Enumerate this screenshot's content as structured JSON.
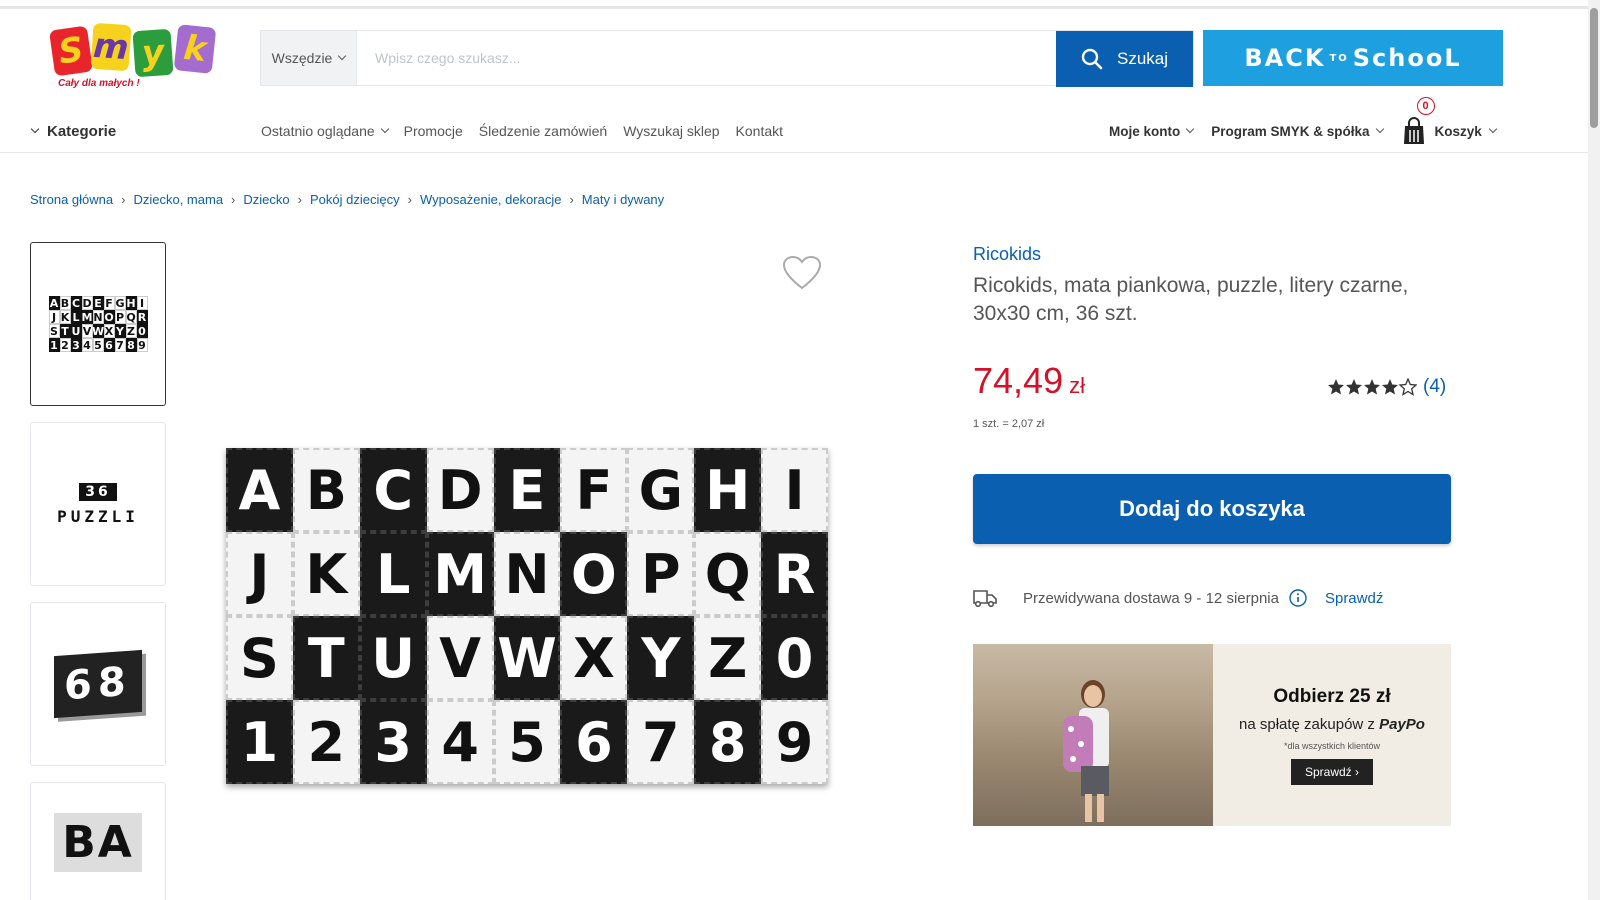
{
  "logo": {
    "letters": [
      "S",
      "m",
      "y",
      "k"
    ],
    "slogan": "Cały dla małych !"
  },
  "search": {
    "scope": "Wszędzie",
    "placeholder": "Wpisz czego szukasz...",
    "value": "",
    "button_label": "Szukaj"
  },
  "promo_banner_top": {
    "text": "BACK",
    "small": "TO",
    "text2": "SchooL"
  },
  "nav": {
    "categories_label": "Kategorie",
    "links": [
      "Ostatnio oglądane",
      "Promocje",
      "Śledzenie zamówień",
      "Wyszukaj sklep",
      "Kontakt"
    ],
    "account_label": "Moje konto",
    "program_label": "Program SMYK & spółka",
    "cart_label": "Koszyk",
    "cart_count": "0"
  },
  "breadcrumb": [
    "Strona główna",
    "Dziecko, mama",
    "Dziecko",
    "Pokój dziecięcy",
    "Wyposażenie, dekoracje",
    "Maty i dywany"
  ],
  "thumbnails": {
    "thumb2_top": "36",
    "thumb2_bottom": "PUZZLI",
    "thumb3_text": "68",
    "thumb4_text": "BA"
  },
  "product": {
    "brand": "Ricokids",
    "title": "Ricokids, mata piankowa, puzzle, litery czarne, 30x30 cm, 36 szt.",
    "price": "74,49",
    "currency": "zł",
    "unit_price": "1 szt. = 2,07 zł",
    "rating_value": 4.5,
    "rating_count": "(4)",
    "add_to_cart_label": "Dodaj do koszyka",
    "delivery_text": "Przewidywana dostawa 9 - 12 sierpnia",
    "delivery_check_label": "Sprawdź"
  },
  "mat_tiles": [
    [
      "A",
      "b"
    ],
    [
      "B",
      "w"
    ],
    [
      "C",
      "b"
    ],
    [
      "D",
      "w"
    ],
    [
      "E",
      "b"
    ],
    [
      "F",
      "w"
    ],
    [
      "G",
      "w"
    ],
    [
      "H",
      "b"
    ],
    [
      "I",
      "w"
    ],
    [
      "J",
      "w"
    ],
    [
      "K",
      "w"
    ],
    [
      "L",
      "b"
    ],
    [
      "M",
      "b"
    ],
    [
      "N",
      "w"
    ],
    [
      "O",
      "b"
    ],
    [
      "P",
      "w"
    ],
    [
      "Q",
      "w"
    ],
    [
      "R",
      "b"
    ],
    [
      "S",
      "w"
    ],
    [
      "T",
      "b"
    ],
    [
      "U",
      "b"
    ],
    [
      "V",
      "w"
    ],
    [
      "W",
      "b"
    ],
    [
      "X",
      "w"
    ],
    [
      "Y",
      "b"
    ],
    [
      "Z",
      "w"
    ],
    [
      "0",
      "b"
    ],
    [
      "1",
      "b"
    ],
    [
      "2",
      "w"
    ],
    [
      "3",
      "b"
    ],
    [
      "4",
      "w"
    ],
    [
      "5",
      "w"
    ],
    [
      "6",
      "b"
    ],
    [
      "7",
      "w"
    ],
    [
      "8",
      "b"
    ],
    [
      "9",
      "w"
    ]
  ],
  "paypo_banner": {
    "title": "Odbierz 25 zł",
    "subtitle": "na spłatę zakupów z",
    "brand": "PayPo",
    "note": "*dla wszystkich klientów",
    "button": "Sprawdź"
  },
  "colors": {
    "primary_blue": "#0a5fb0",
    "price_red": "#d3122a",
    "banner_blue": "#1e9fe0"
  }
}
